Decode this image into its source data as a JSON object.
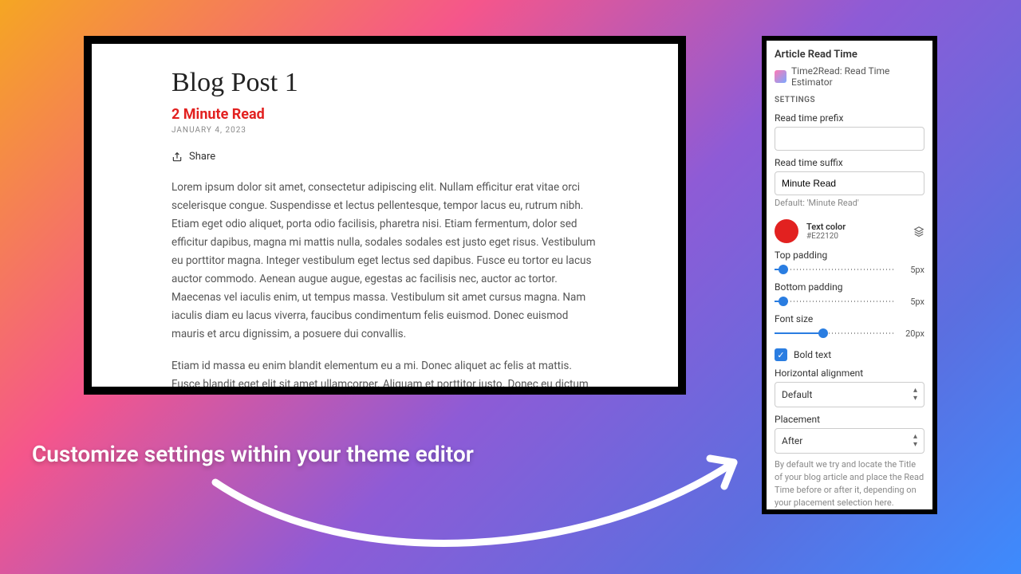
{
  "blog": {
    "title": "Blog Post 1",
    "read_time": "2 Minute Read",
    "date": "JANUARY 4, 2023",
    "share_label": "Share",
    "para1": "Lorem ipsum dolor sit amet, consectetur adipiscing elit. Nullam efficitur erat vitae orci scelerisque congue. Suspendisse et lectus pellentesque, tempor lacus eu, rutrum nibh. Etiam eget odio aliquet, porta odio facilisis, pharetra nisi. Etiam fermentum, dolor sed efficitur dapibus, magna mi mattis nulla, sodales sodales est justo eget risus. Vestibulum eu porttitor magna. Integer vestibulum eget lectus sed dapibus. Fusce eu tortor eu lacus auctor commodo. Aenean augue augue, egestas ac facilisis nec, auctor ac tortor. Maecenas vel iaculis enim, ut tempus massa. Vestibulum sit amet cursus magna. Nam iaculis diam eu lacus viverra, faucibus condimentum felis euismod. Donec euismod mauris et arcu dignissim, a posuere dui convallis.",
    "para2": "Etiam id massa eu enim blandit elementum eu a mi. Donec aliquet ac felis at mattis. Fusce blandit eget elit sit amet ullamcorper. Aliquam et porttitor justo. Donec eu dictum risus. Phasellus luctus nisl fringilla ultrices dictum. Nunc rhoncus magna id erat fringilla venenatis. Praesent quis ligula dictum massa tristique gravida quis dignissim eros. Fusce dictum arcu eu lacus tristique rhoncus. Nunc lacus"
  },
  "panel": {
    "title": "Article Read Time",
    "app_name": "Time2Read: Read Time Estimator",
    "settings_header": "SETTINGS",
    "prefix_label": "Read time prefix",
    "prefix_value": "",
    "suffix_label": "Read time suffix",
    "suffix_value": "Minute Read",
    "suffix_hint": "Default: 'Minute Read'",
    "color_label": "Text color",
    "color_hex": "#E22120",
    "top_padding_label": "Top padding",
    "top_padding_value": "5px",
    "bottom_padding_label": "Bottom padding",
    "bottom_padding_value": "5px",
    "font_size_label": "Font size",
    "font_size_value": "20px",
    "bold_label": "Bold text",
    "halign_label": "Horizontal alignment",
    "halign_value": "Default",
    "placement_label": "Placement",
    "placement_value": "After",
    "placement_desc": "By default we try and locate the Title of your blog article and place the Read Time before or after it, depending on your placement selection here."
  },
  "caption": "Customize settings within your theme editor"
}
